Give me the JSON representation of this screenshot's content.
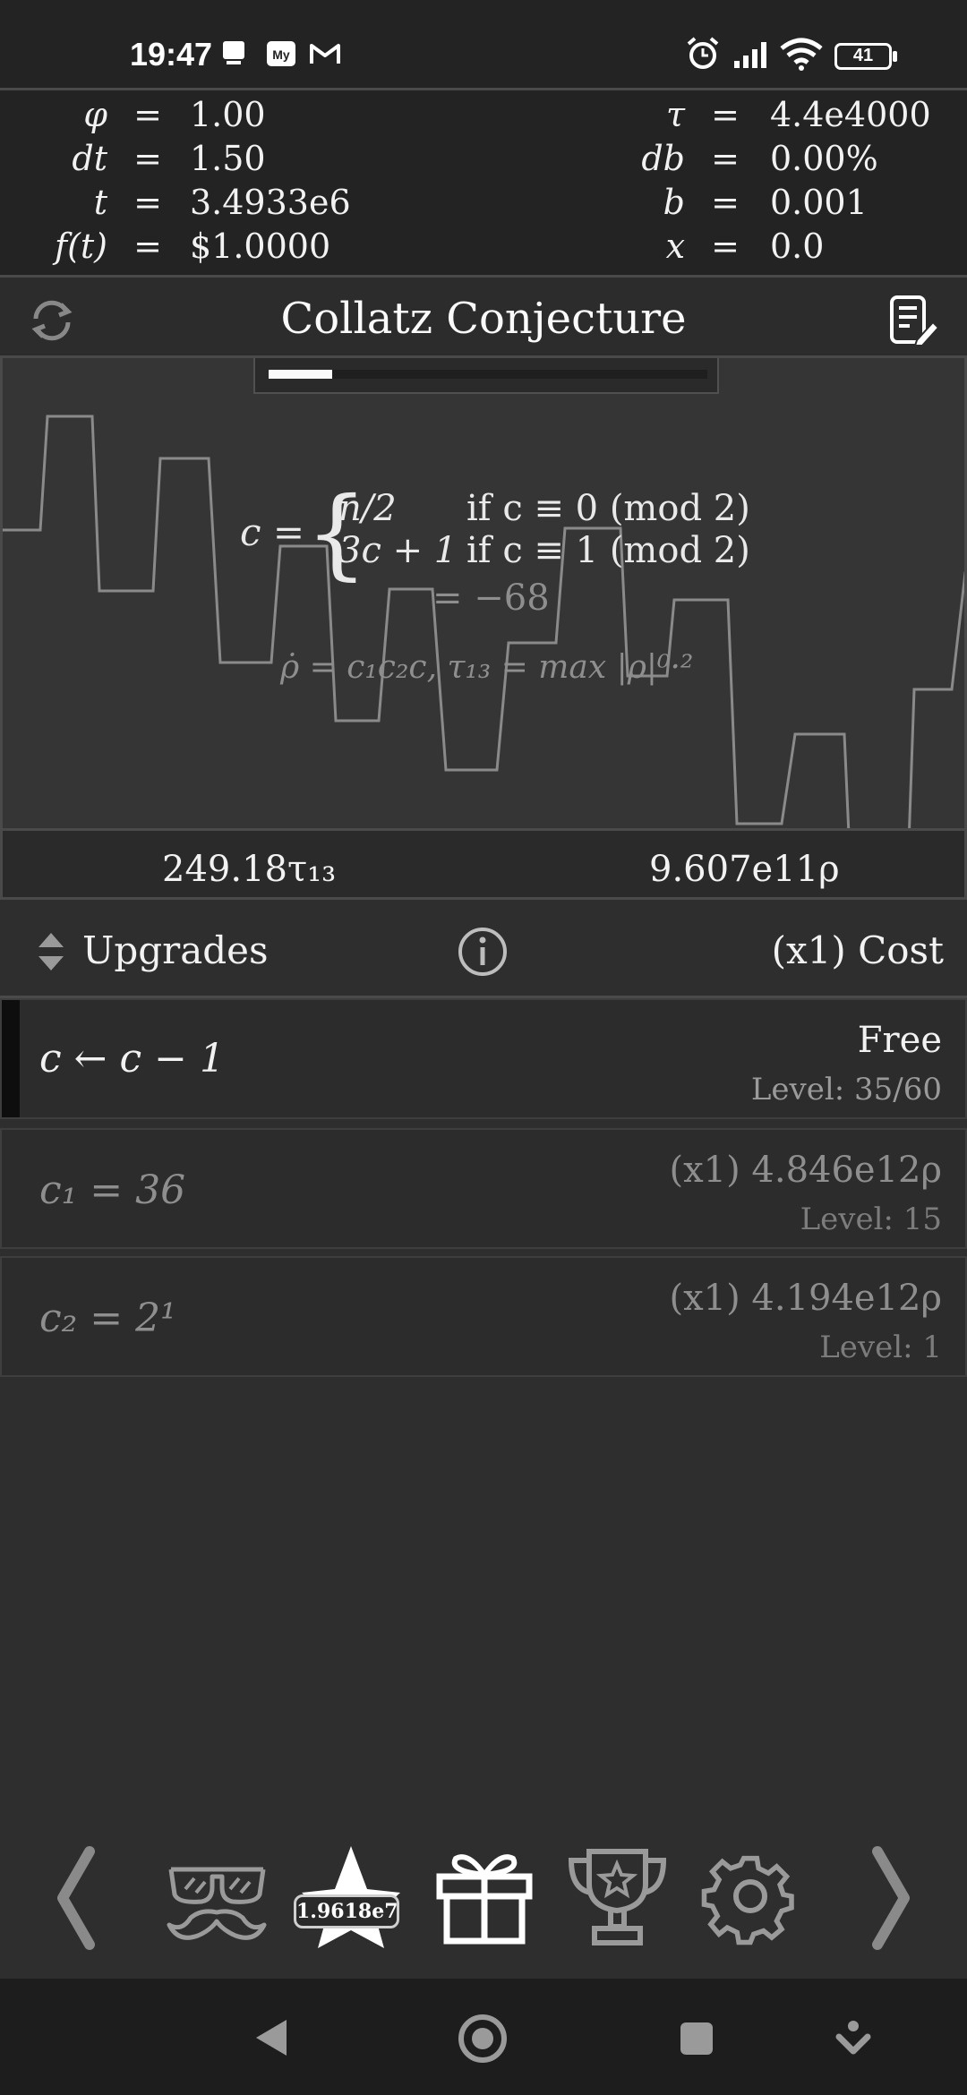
{
  "status": {
    "time": "19:47",
    "battery": "41"
  },
  "stats": {
    "left": [
      {
        "sym": "φ",
        "val": "1.00"
      },
      {
        "sym": "dt",
        "val": "1.50"
      },
      {
        "sym": "t",
        "val": "3.4933e6"
      },
      {
        "sym": "f(t)",
        "val": "$1.0000"
      }
    ],
    "right": [
      {
        "sym": "τ",
        "val": "4.4e4000"
      },
      {
        "sym": "db",
        "val": "0.00%"
      },
      {
        "sym": "b",
        "val": "0.001"
      },
      {
        "sym": "x",
        "val": "0.0"
      }
    ],
    "equals": "="
  },
  "title": "Collatz Conjecture",
  "progress": {
    "fraction": 0.145
  },
  "formula": {
    "lhs": "c =",
    "case1_expr": "n/2",
    "case1_cond": "if c ≡ 0 (mod 2)",
    "case2_expr": "3c + 1",
    "case2_cond": "if c ≡ 1 (mod 2)",
    "current": "= −68",
    "rate": "ρ̇ = c₁c₂c,   τ₁₃ = max |ρ|⁰·²"
  },
  "currency": {
    "tau": "249.18τ₁₃",
    "rho": "9.607e11ρ"
  },
  "upgrades_header": {
    "label": "Upgrades",
    "cost_label": "(x1) Cost"
  },
  "upgrades": [
    {
      "name": "c ← c − 1",
      "cost": "Free",
      "level": "Level: 35/60"
    },
    {
      "name": "c₁ = 36",
      "cost": "(x1) 4.846e12ρ",
      "level": "Level: 15"
    },
    {
      "name": "c₂ = 2¹",
      "cost": "(x1) 4.194e12ρ",
      "level": "Level: 1"
    }
  ],
  "bottomnav": {
    "badge": "1.9618e7"
  },
  "colors": {
    "bg": "#2e2e2e",
    "panel": "#232323",
    "text": "#f2f2f2",
    "muted": "#8e8e8e"
  }
}
